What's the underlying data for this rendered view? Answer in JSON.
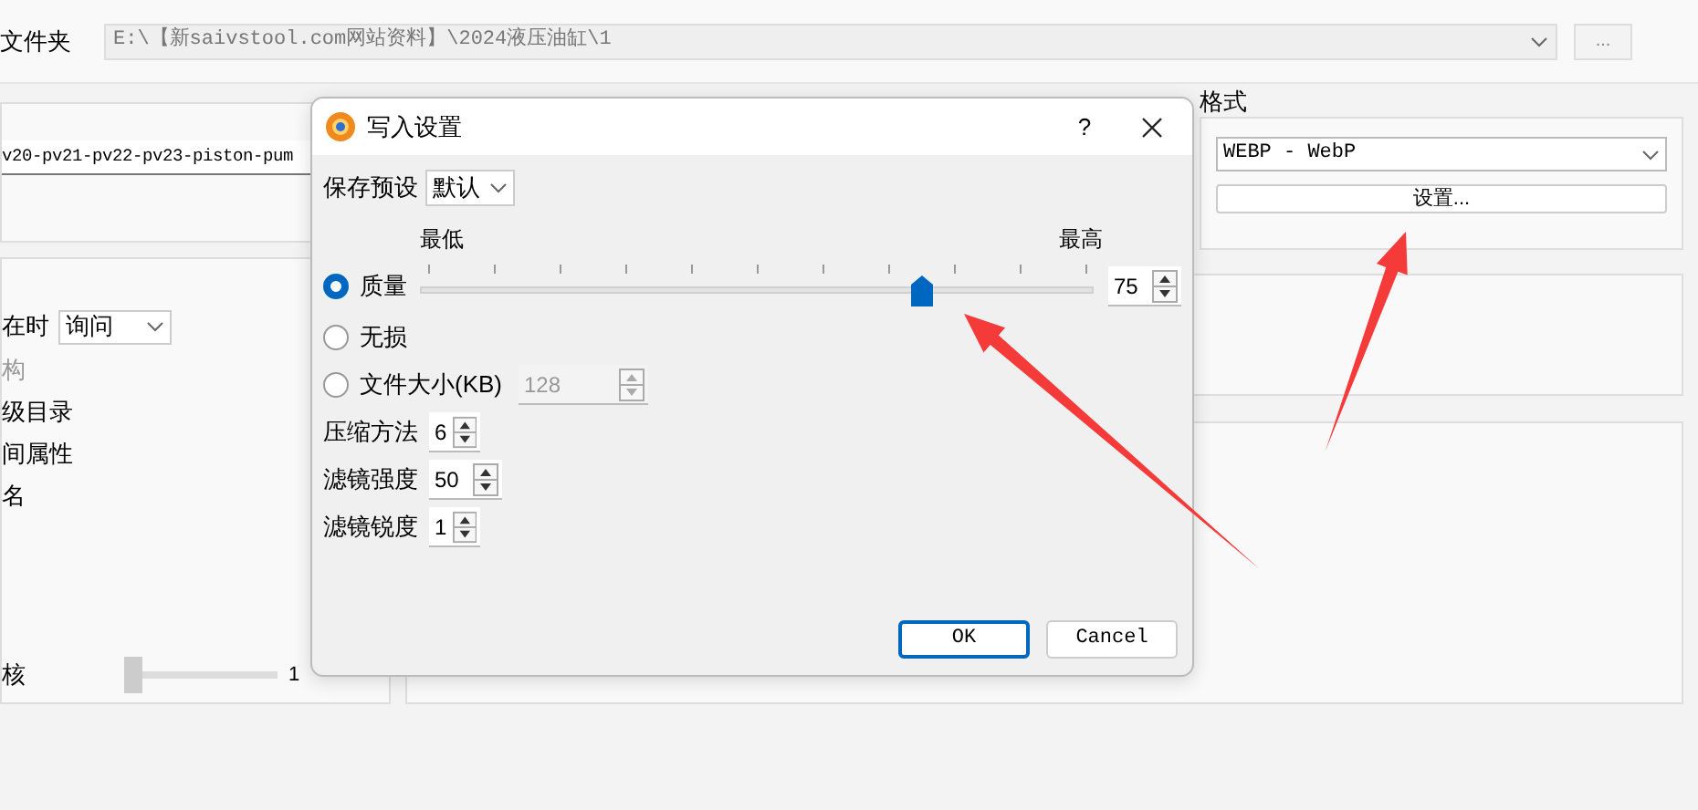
{
  "folder": {
    "label": "文件夹",
    "path": "E:\\【新saivstool.com网站资料】\\2024液压油缸\\1",
    "browse": "..."
  },
  "filename": {
    "value": "v20-pv21-pv22-pv23-piston-pum"
  },
  "format": {
    "title": "格式",
    "value": "WEBP - WebP",
    "settings_button": "设置..."
  },
  "options": [
    {
      "kind": "combo",
      "label": "在时",
      "value": "询问"
    },
    {
      "kind": "text",
      "label": "构",
      "disabled": true
    },
    {
      "kind": "text",
      "label": "级目录",
      "disabled": false
    },
    {
      "kind": "text",
      "label": "间属性",
      "disabled": false
    },
    {
      "kind": "text",
      "label": "名",
      "disabled": false
    },
    {
      "kind": "slider",
      "label": "核",
      "level": 0,
      "reading": "1"
    }
  ],
  "dialog": {
    "title": "写入设置",
    "help": "?",
    "preset_label": "保存预设",
    "preset_value": "默认",
    "min_label": "最低",
    "max_label": "最高",
    "modes": [
      {
        "kind": "slider",
        "label": "质量",
        "selected": true,
        "level": 0.75,
        "value": "75"
      },
      {
        "kind": "plain",
        "label": "无损",
        "selected": false
      },
      {
        "kind": "spin",
        "label": "文件大小(KB)",
        "selected": false,
        "value": "128"
      }
    ],
    "params": [
      {
        "label": "压缩方法",
        "value": "6"
      },
      {
        "label": "滤镜强度",
        "value": "50"
      },
      {
        "label": "滤镜锐度",
        "value": "1"
      }
    ],
    "buttons": [
      {
        "label": "OK",
        "default": true
      },
      {
        "label": "Cancel",
        "default": false
      }
    ]
  }
}
